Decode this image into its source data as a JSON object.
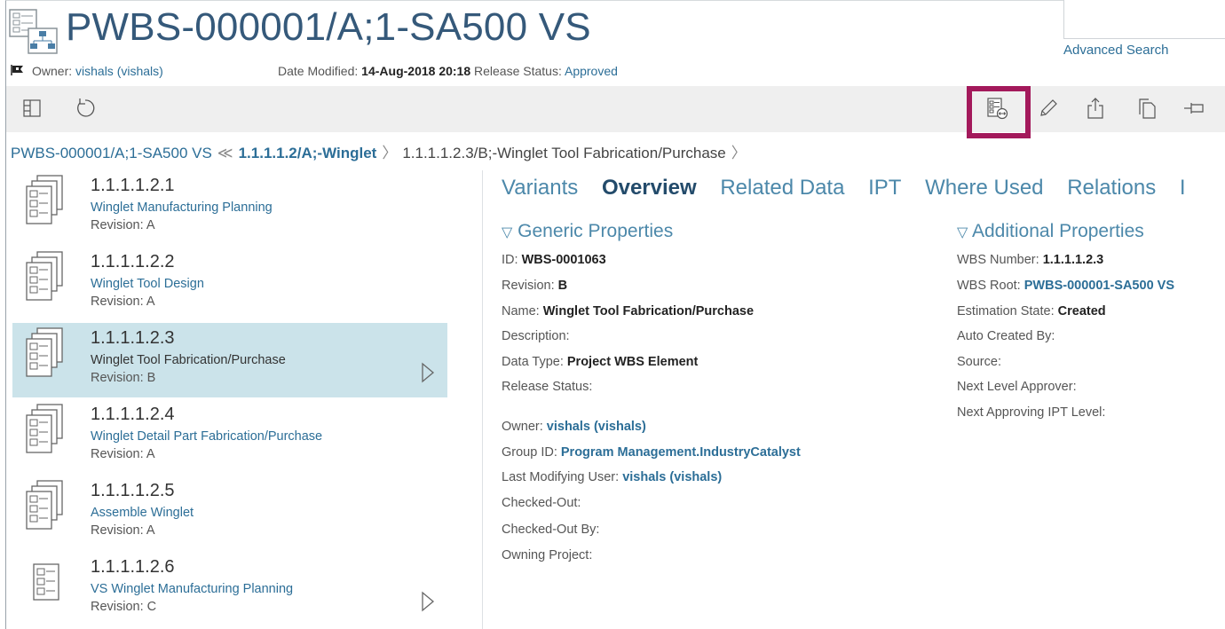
{
  "header": {
    "title": "PWBS-000001/A;1-SA500 VS",
    "advanced_search": "Advanced Search",
    "owner_label": "Owner:",
    "owner_value": "vishals (vishals)",
    "date_label": "Date Modified:",
    "date_value": "14-Aug-2018 20:18",
    "release_label": "Release Status:",
    "release_value": "Approved"
  },
  "toolbar": {
    "icons": [
      "panel-layout-icon",
      "refresh-icon",
      "structure-compare-icon",
      "edit-icon",
      "share-icon",
      "copy-icon",
      "pin-icon"
    ]
  },
  "breadcrumb": {
    "root": "PWBS-000001/A;1-SA500 VS",
    "sep1": "≪",
    "parent": "1.1.1.1.2/A;-Winglet",
    "sep2": "〉",
    "current": "1.1.1.1.2.3/B;-Winglet Tool Fabrication/Purchase",
    "sep3": "〉"
  },
  "list": {
    "items": [
      {
        "number": "1.1.1.1.2.1",
        "name": "Winglet Manufacturing Planning",
        "revision": "Revision:  A"
      },
      {
        "number": "1.1.1.1.2.2",
        "name": "Winglet Tool Design",
        "revision": "Revision:  A"
      },
      {
        "number": "1.1.1.1.2.3",
        "name": "Winglet Tool Fabrication/Purchase",
        "revision": "Revision:  B"
      },
      {
        "number": "1.1.1.1.2.4",
        "name": "Winglet Detail Part Fabrication/Purchase",
        "revision": "Revision:  A"
      },
      {
        "number": "1.1.1.1.2.5",
        "name": "Assemble Winglet",
        "revision": "Revision:  A"
      },
      {
        "number": "1.1.1.1.2.6",
        "name": "VS Winglet Manufacturing Planning",
        "revision": "Revision:  C"
      }
    ]
  },
  "tabs": [
    "Variants",
    "Overview",
    "Related Data",
    "IPT",
    "Where Used",
    "Relations",
    "I"
  ],
  "generic": {
    "title": "Generic Properties",
    "props": [
      {
        "label": "ID:",
        "value": "WBS-0001063"
      },
      {
        "label": "Revision:",
        "value": "B"
      },
      {
        "label": "Name:",
        "value": "Winglet Tool Fabrication/Purchase"
      },
      {
        "label": "Description:",
        "value": ""
      },
      {
        "label": "Data Type:",
        "value": "Project WBS Element"
      },
      {
        "label": "Release Status:",
        "value": ""
      },
      {
        "label": "Owner:",
        "value": "vishals (vishals)"
      },
      {
        "label": "Group ID:",
        "value": "Program Management.IndustryCatalyst"
      },
      {
        "label": "Last Modifying User:",
        "value": "vishals (vishals)"
      },
      {
        "label": "Checked-Out:",
        "value": ""
      },
      {
        "label": "Checked-Out By:",
        "value": ""
      },
      {
        "label": "Owning Project:",
        "value": ""
      }
    ]
  },
  "additional": {
    "title": "Additional Properties",
    "props": [
      {
        "label": "WBS Number:",
        "value": "1.1.1.1.2.3"
      },
      {
        "label": "WBS Root:",
        "value": "PWBS-000001-SA500 VS"
      },
      {
        "label": "Estimation State:",
        "value": "Created"
      },
      {
        "label": "Auto Created By:",
        "value": ""
      },
      {
        "label": "Source:",
        "value": ""
      },
      {
        "label": "Next Level Approver:",
        "value": ""
      },
      {
        "label": "Next Approving IPT Level:",
        "value": ""
      }
    ]
  }
}
